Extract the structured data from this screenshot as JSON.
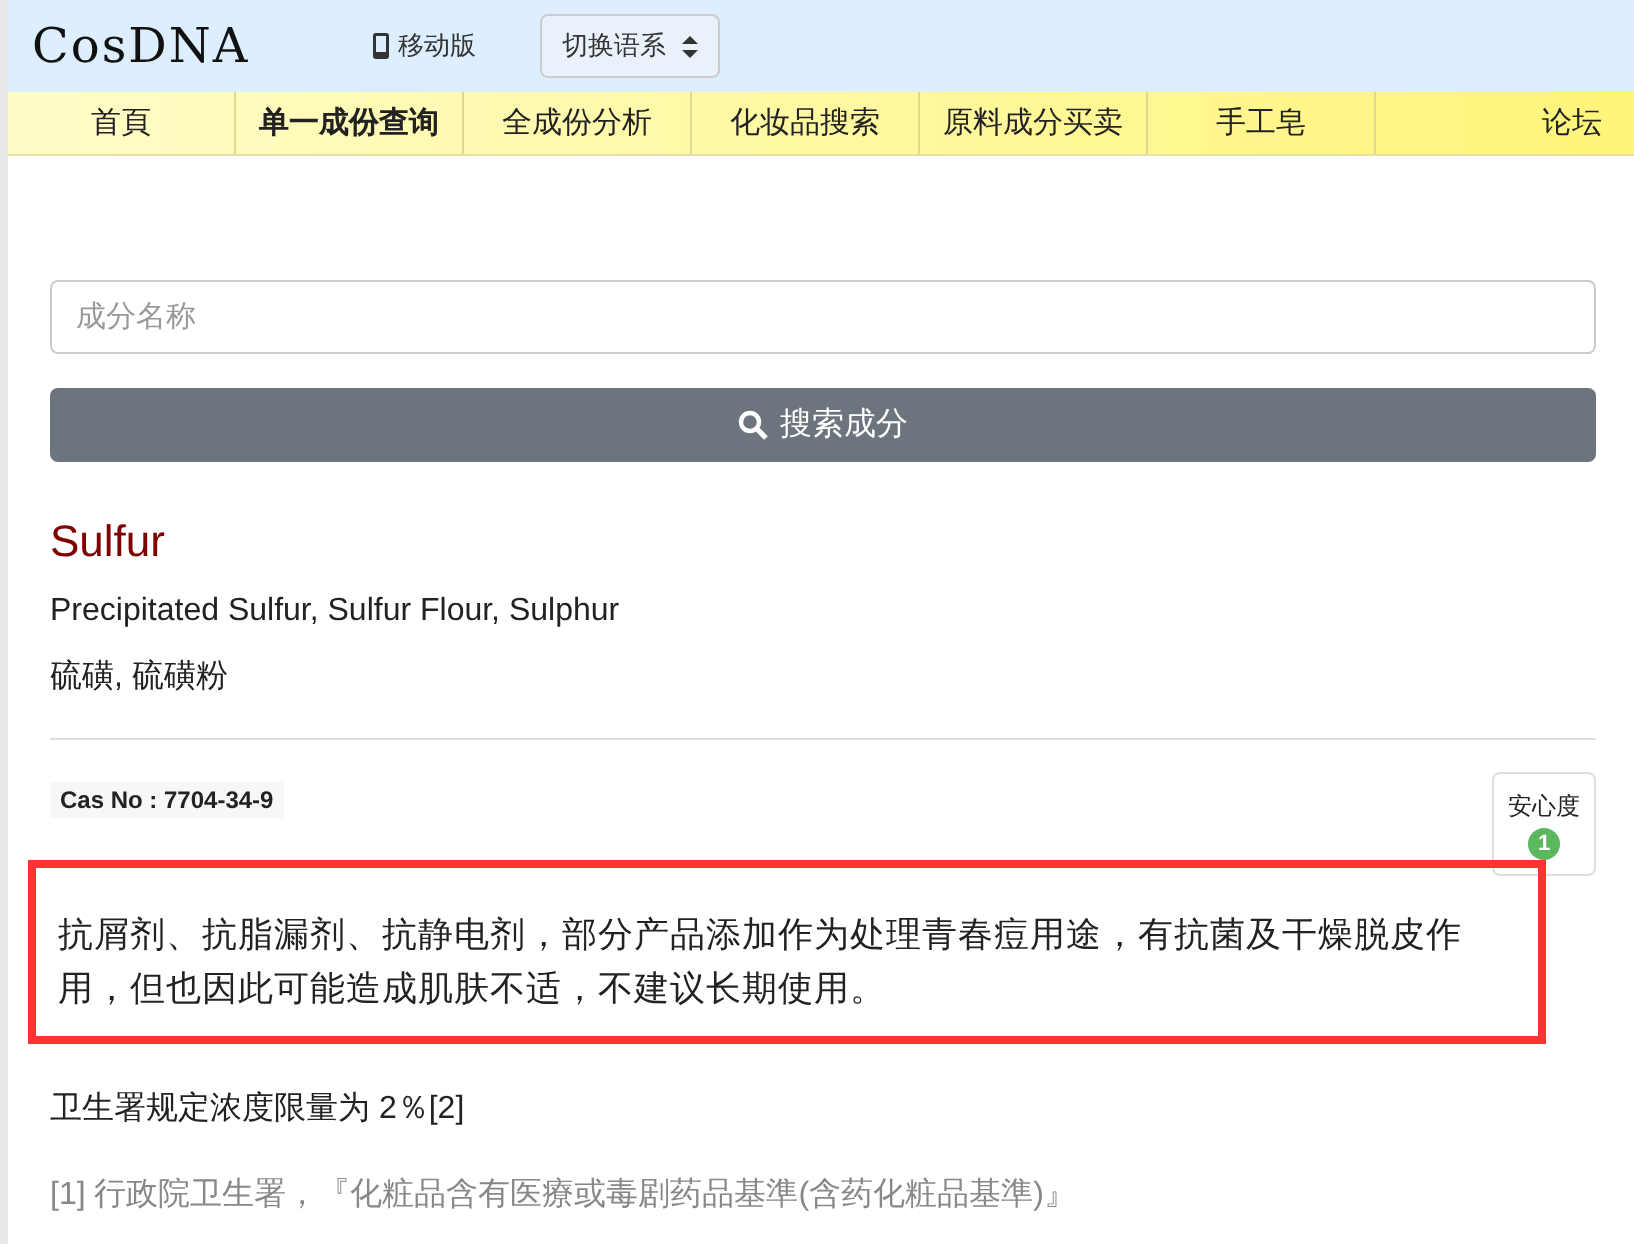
{
  "header": {
    "logo": "CosDNA",
    "mobile_link": "移动版",
    "language_select": "切换语系"
  },
  "nav": [
    {
      "label": "首頁",
      "selected": false
    },
    {
      "label": "单一成份查询",
      "selected": true
    },
    {
      "label": "全成份分析",
      "selected": false
    },
    {
      "label": "化妆品搜索",
      "selected": false
    },
    {
      "label": "原料成分买卖",
      "selected": false
    },
    {
      "label": "手工皂",
      "selected": false
    },
    {
      "label": "论坛",
      "selected": false
    }
  ],
  "search": {
    "placeholder": "成分名称",
    "button": "搜索成分"
  },
  "ingredient": {
    "name": "Sulfur",
    "aliases": "Precipitated Sulfur, Sulfur Flour, Sulphur",
    "chinese_names": "硫磺, 硫磺粉",
    "cas": "Cas No : 7704-34-9",
    "safety_label": "安心度",
    "safety_score": "1"
  },
  "description": {
    "text": "抗屑剂、抗脂漏剂、抗静电剂，部分产品添加作为处理青春痘用途，有抗菌及干燥脱皮作用，但也因此可能造成肌肤不适，不建议长期使用。",
    "highlighted": true
  },
  "regulation": "卫生署规定浓度限量为 2％[2]",
  "reference": "[1] 行政院卫生署，『化粧品含有医療或毒剧药品基準(含药化粧品基準)』"
}
